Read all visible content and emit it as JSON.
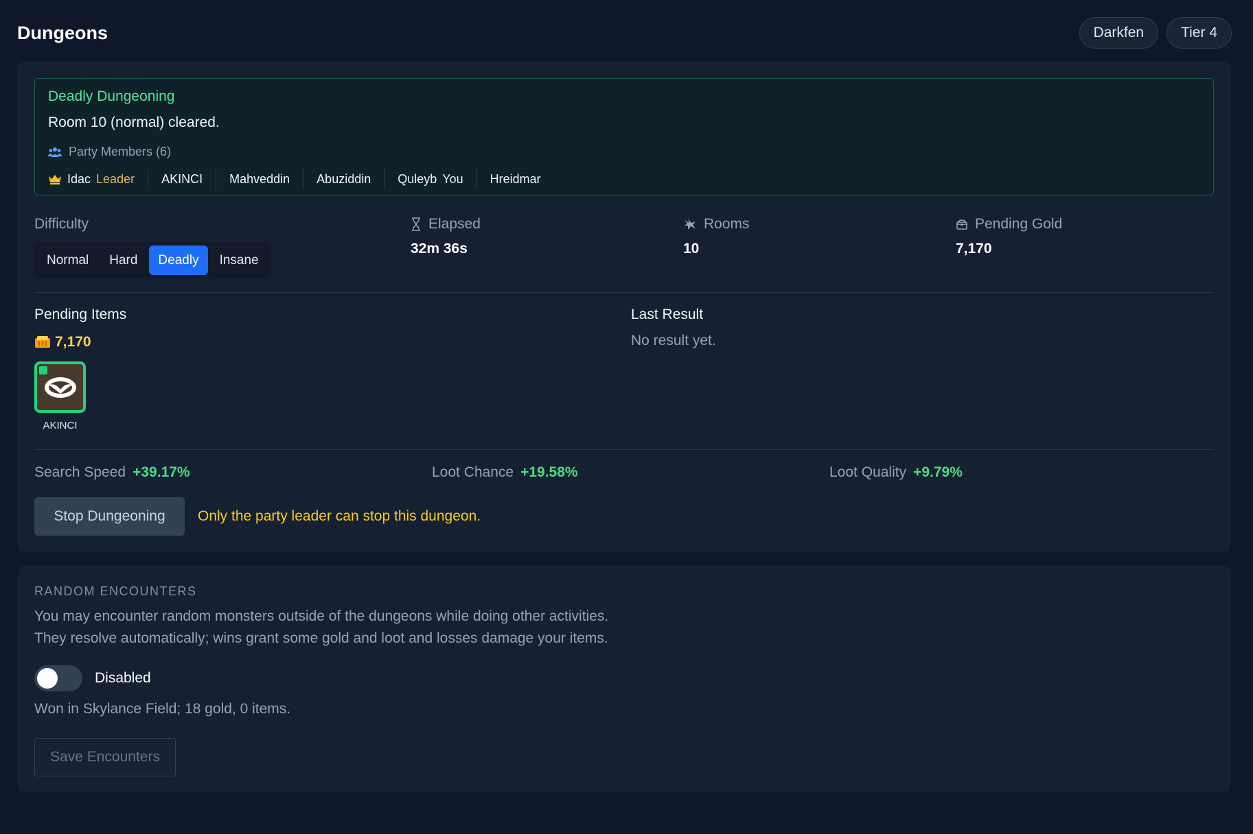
{
  "header": {
    "title": "Dungeons",
    "region": "Darkfen",
    "tier": "Tier 4"
  },
  "banner": {
    "mode": "Deadly Dungeoning",
    "message": "Room 10 (normal) cleared.",
    "party_label": "Party Members (6)",
    "members": [
      {
        "name": "Idac",
        "tag": "Leader"
      },
      {
        "name": "AKINCI",
        "tag": ""
      },
      {
        "name": "Mahveddin",
        "tag": ""
      },
      {
        "name": "Abuziddin",
        "tag": ""
      },
      {
        "name": "Quleyb",
        "tag": "You"
      },
      {
        "name": "Hreidmar",
        "tag": ""
      }
    ]
  },
  "difficulty": {
    "label": "Difficulty",
    "options": [
      "Normal",
      "Hard",
      "Deadly",
      "Insane"
    ],
    "selected": "Deadly"
  },
  "stats": {
    "elapsed_label": "Elapsed",
    "elapsed_value": "32m 36s",
    "rooms_label": "Rooms",
    "rooms_value": "10",
    "gold_label": "Pending Gold",
    "gold_value": "7,170"
  },
  "pending": {
    "title": "Pending Items",
    "gold": "7,170",
    "item_owner": "AKINCI"
  },
  "last_result": {
    "title": "Last Result",
    "text": "No result yet."
  },
  "bonuses": {
    "search_label": "Search Speed",
    "search_value": "+39.17%",
    "chance_label": "Loot Chance",
    "chance_value": "+19.58%",
    "quality_label": "Loot Quality",
    "quality_value": "+9.79%"
  },
  "actions": {
    "stop_label": "Stop Dungeoning",
    "stop_note": "Only the party leader can stop this dungeon."
  },
  "encounters": {
    "title": "RANDOM ENCOUNTERS",
    "desc_line1": "You may encounter random monsters outside of the dungeons while doing other activities.",
    "desc_line2": "They resolve automatically; wins grant some gold and loot and losses damage your items.",
    "toggle_label": "Disabled",
    "toggle_on": false,
    "result": "Won in Skylance Field; 18 gold, 0 items.",
    "save_label": "Save Encounters"
  },
  "colors": {
    "background": "#0f172a",
    "card": "#162033",
    "accent_blue": "#1d6ef5",
    "success_green": "#4ade80",
    "warning_yellow": "#facc15"
  }
}
